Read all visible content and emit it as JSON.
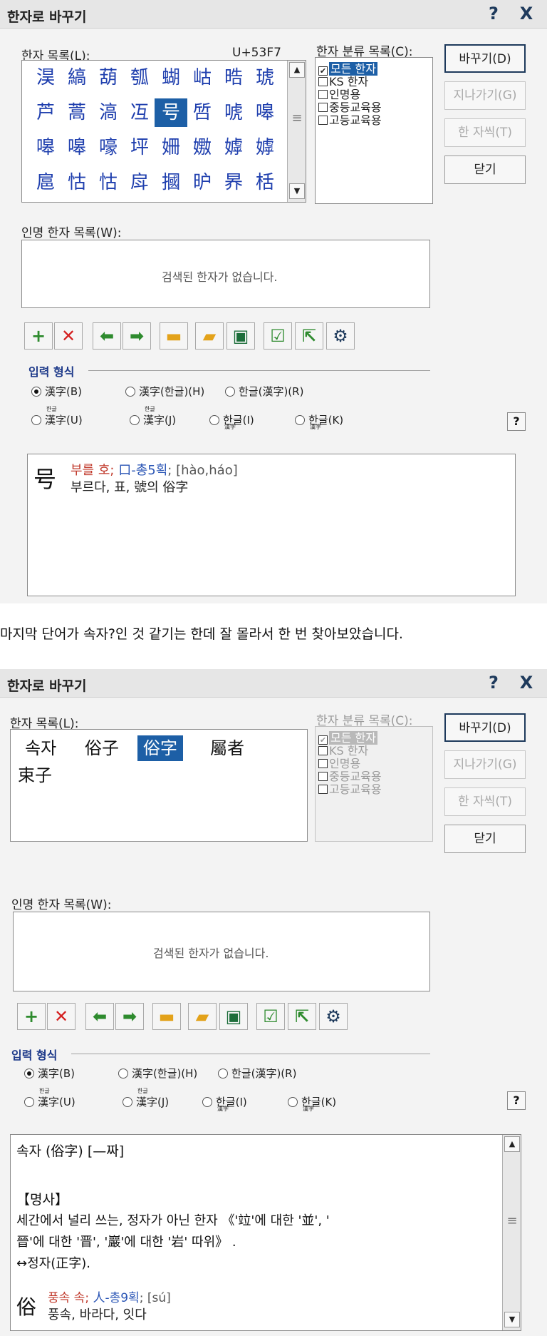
{
  "dialog1": {
    "title": "한자로 바꾸기",
    "help_glyph": "?",
    "close_glyph": "X",
    "hanja_list_label": "한자 목록(L):",
    "unicode_code": "U+53F7",
    "hanja_grid": [
      [
        "淏",
        "縞",
        "葫",
        "瓠",
        "蝴",
        "岵",
        "晧",
        "琥"
      ],
      [
        "芦",
        "蒿",
        "滈",
        "冱",
        "号",
        "啠",
        "唬",
        "嗥"
      ],
      [
        "嗥",
        "嗥",
        "嚎",
        "坪",
        "姍",
        "嫐",
        "嫭",
        "嫭"
      ],
      [
        "扈",
        "怙",
        "怙",
        "戽",
        "摑",
        "昈",
        "昦",
        "栝"
      ]
    ],
    "selected_hanja": "号",
    "category_label": "한자 분류 목록(C):",
    "categories": [
      {
        "label": "모든 한자",
        "checked": true
      },
      {
        "label": "KS 한자",
        "checked": false
      },
      {
        "label": "인명용",
        "checked": false
      },
      {
        "label": "중등교육용",
        "checked": false
      },
      {
        "label": "고등교육용",
        "checked": false
      }
    ],
    "buttons": {
      "replace": "바꾸기(D)",
      "skip": "지나가기(G)",
      "detail": "한 자씩(T)",
      "close": "닫기"
    },
    "name_hanja_label": "인명 한자 목록(W):",
    "empty_message": "검색된 한자가 없습니다.",
    "input_format_label": "입력 형식",
    "radios": [
      {
        "label": "漢字(B)",
        "checked": true
      },
      {
        "label": "漢字(한글)(H)",
        "checked": false
      },
      {
        "label": "한글(漢字)(R)",
        "checked": false
      },
      {
        "label": "漢字(U)",
        "ruby": "한글",
        "checked": false
      },
      {
        "label": "漢字(J)",
        "ruby": "한글",
        "checked": false
      },
      {
        "label": "한글(I)",
        "ruby": "漢字",
        "checked": false
      },
      {
        "label": "한글(K)",
        "ruby": "漢字",
        "checked": false
      }
    ],
    "info": {
      "char": "号",
      "reading": "부를 호",
      "radical": "口-총5획",
      "pinyin": "[hào,háo]",
      "meaning": "부르다, 표, 號의 俗字"
    }
  },
  "caption": "마지막 단어가 속자?인 것 같기는 한데 잘 몰라서 한 번 찾아보았습니다.",
  "dialog2": {
    "title": "한자로 바꾸기",
    "help_glyph": "?",
    "close_glyph": "X",
    "hanja_list_label": "한자 목록(L):",
    "word_list": [
      "속자",
      "俗子",
      "俗字",
      "屬者",
      "束子"
    ],
    "selected_word": "俗字",
    "category_label": "한자 분류 목록(C):",
    "categories": [
      {
        "label": "모든 한자",
        "checked": true
      },
      {
        "label": "KS 한자",
        "checked": false
      },
      {
        "label": "인명용",
        "checked": false
      },
      {
        "label": "중등교육용",
        "checked": false
      },
      {
        "label": "고등교육용",
        "checked": false
      }
    ],
    "buttons": {
      "replace": "바꾸기(D)",
      "skip": "지나가기(G)",
      "detail": "한 자씩(T)",
      "close": "닫기"
    },
    "name_hanja_label": "인명 한자 목록(W):",
    "empty_message": "검색된 한자가 없습니다.",
    "input_format_label": "입력 형식",
    "radios": [
      {
        "label": "漢字(B)",
        "checked": true
      },
      {
        "label": "漢字(한글)(H)",
        "checked": false
      },
      {
        "label": "한글(漢字)(R)",
        "checked": false
      },
      {
        "label": "漢字(U)",
        "ruby": "한글",
        "checked": false
      },
      {
        "label": "漢字(J)",
        "ruby": "한글",
        "checked": false
      },
      {
        "label": "한글(I)",
        "ruby": "漢字",
        "checked": false
      },
      {
        "label": "한글(K)",
        "ruby": "漢字",
        "checked": false
      }
    ],
    "dictionary": {
      "headword": "속자 (俗字) [—짜]",
      "pos": "【명사】",
      "definition_1": "세간에서 널리 쓰는, 정자가 아닌 한자 《'竝'에 대한 '並', '",
      "definition_2": "晉'에 대한 '晋', '巖'에 대한 '岩' 따위》 .",
      "antonym": "↔정자(正字).",
      "char": "俗",
      "reading": "풍속 속",
      "radical": "人-총9획",
      "pinyin": "[sú]",
      "meaning": "풍속, 바라다, 잇다"
    }
  },
  "colors": {
    "accent": "#1d5fa6",
    "hanja_text": "#1f3fae",
    "reading_red": "#c0392b",
    "section_blue": "#1e3a8a",
    "plus_green": "#2e8b2e",
    "x_red": "#d42020"
  }
}
